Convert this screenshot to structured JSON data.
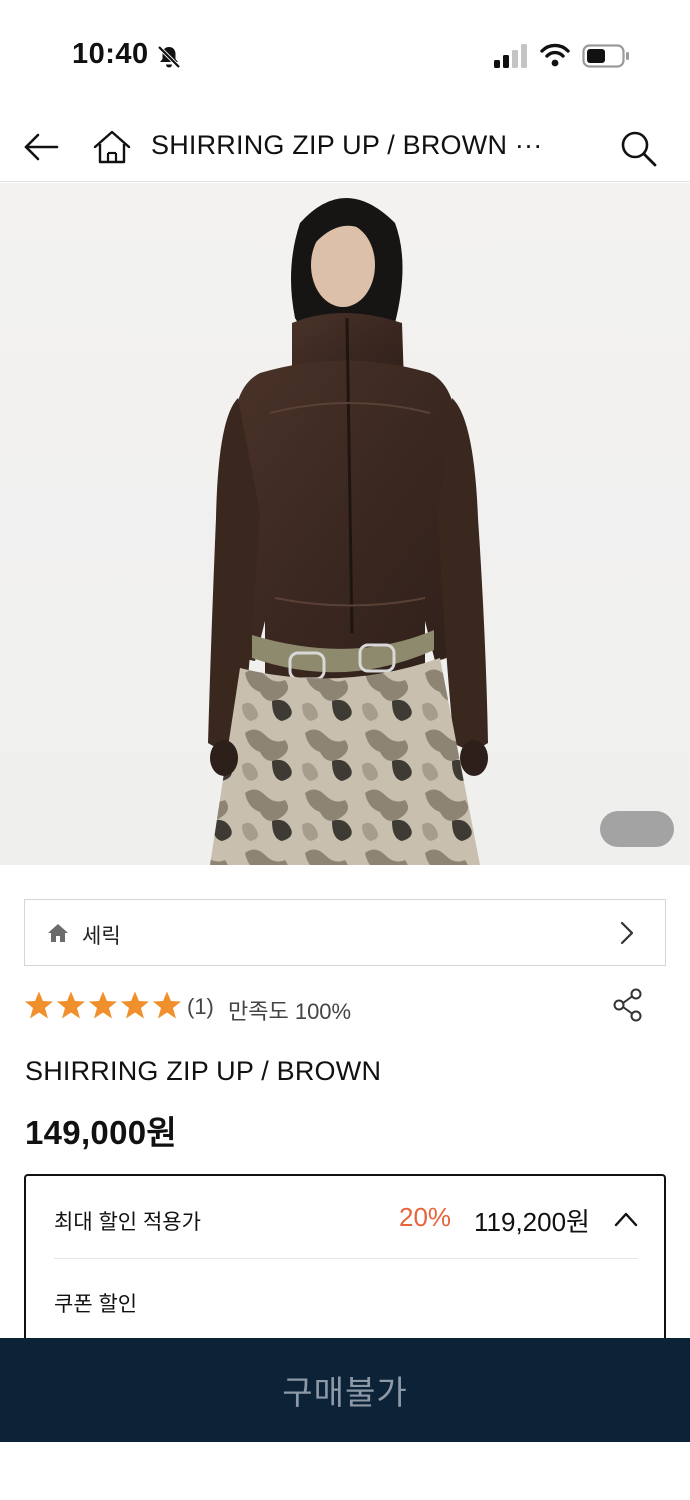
{
  "status_bar": {
    "time": "10:40",
    "icons": [
      "bell-off-icon",
      "signal-icon",
      "wifi-icon",
      "battery-icon"
    ]
  },
  "nav": {
    "title": "SHIRRING ZIP UP / BROWN ···",
    "icons": [
      "back-arrow-icon",
      "home-icon",
      "search-icon"
    ]
  },
  "hero": {
    "image": "model-wearing-brown-shirring-zip-up-photo",
    "indicator": ""
  },
  "brand": {
    "name": "세릭",
    "icons": [
      "home-icon",
      "chevron-right-icon"
    ]
  },
  "rating": {
    "stars": 5,
    "max_stars": 5,
    "review_count": "(1)",
    "satisfaction": "만족도 100%",
    "star_color": "#f0902d"
  },
  "product": {
    "name": "SHIRRING ZIP UP / BROWN",
    "price": "149,000원"
  },
  "discount": {
    "label": "최대 할인 적용가",
    "rate": "20%",
    "price": "119,200원",
    "coupon_label": "쿠폰 할인",
    "rate_color": "#e8643a"
  },
  "buy": {
    "label": "구매불가",
    "background": "#0c2236"
  }
}
